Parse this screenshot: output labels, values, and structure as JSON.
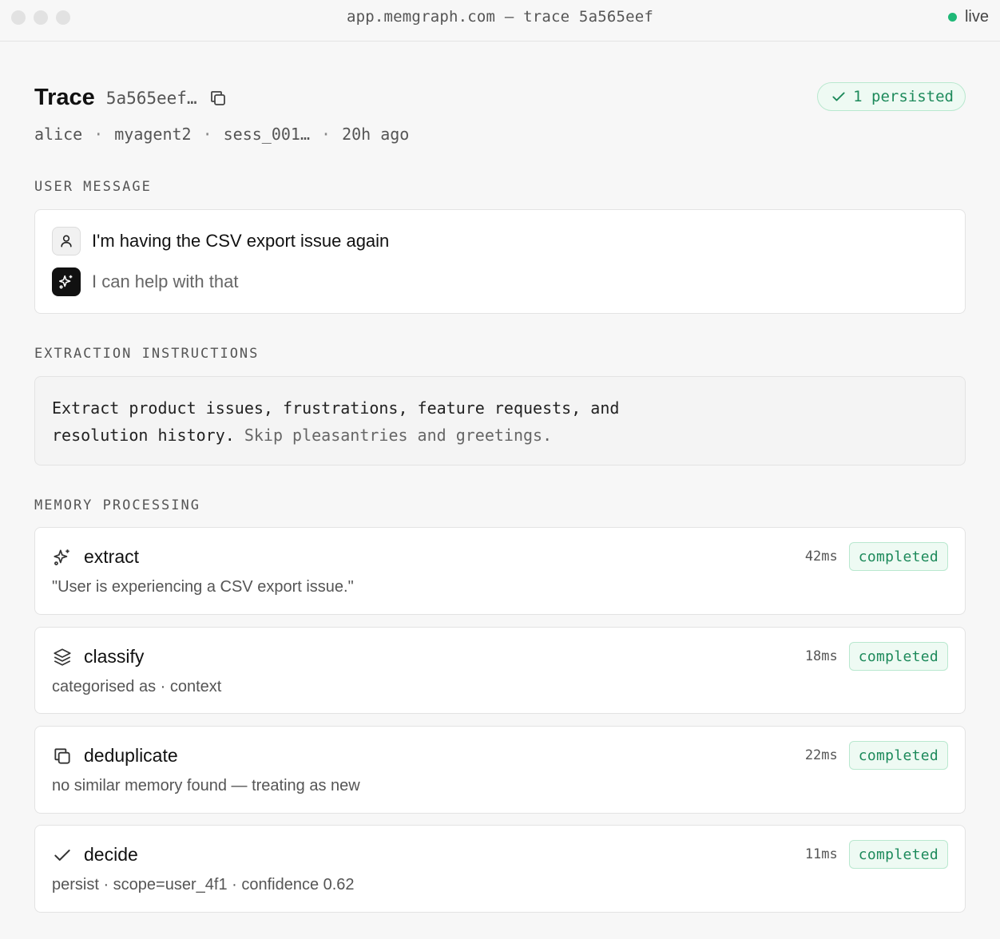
{
  "window": {
    "title": "app.memgraph.com — trace 5a565eef",
    "live_label": "live"
  },
  "trace": {
    "heading": "Trace",
    "id_short": "5a565eef…",
    "persisted_label": "1 persisted",
    "meta": {
      "user": "alice",
      "agent": "myagent2",
      "session": "sess_001…",
      "age": "20h ago"
    }
  },
  "user_message": {
    "label": "USER MESSAGE",
    "user_text": "I'm having the CSV export issue again",
    "assistant_text": "I can help with that"
  },
  "extraction": {
    "label": "EXTRACTION INSTRUCTIONS",
    "text_main": "Extract product issues, frustrations, feature requests, and resolution history.",
    "text_muted": " Skip pleasantries and greetings."
  },
  "memory_processing": {
    "label": "MEMORY PROCESSING",
    "steps": [
      {
        "icon": "sparkles-icon",
        "name": "extract",
        "desc": "\"User is experiencing a CSV export issue.\"",
        "duration": "42ms",
        "status": "completed"
      },
      {
        "icon": "layers-icon",
        "name": "classify",
        "desc": "categorised as · context",
        "duration": "18ms",
        "status": "completed"
      },
      {
        "icon": "copy-icon",
        "name": "deduplicate",
        "desc": "no similar memory found — treating as new",
        "duration": "22ms",
        "status": "completed"
      },
      {
        "icon": "check-icon",
        "name": "decide",
        "desc": "persist · scope=user_4f1 · confidence 0.62",
        "duration": "11ms",
        "status": "completed"
      }
    ]
  },
  "colors": {
    "accent_green": "#1d8a5b",
    "badge_bg": "#eefaf3",
    "live_dot": "#1fb877"
  }
}
